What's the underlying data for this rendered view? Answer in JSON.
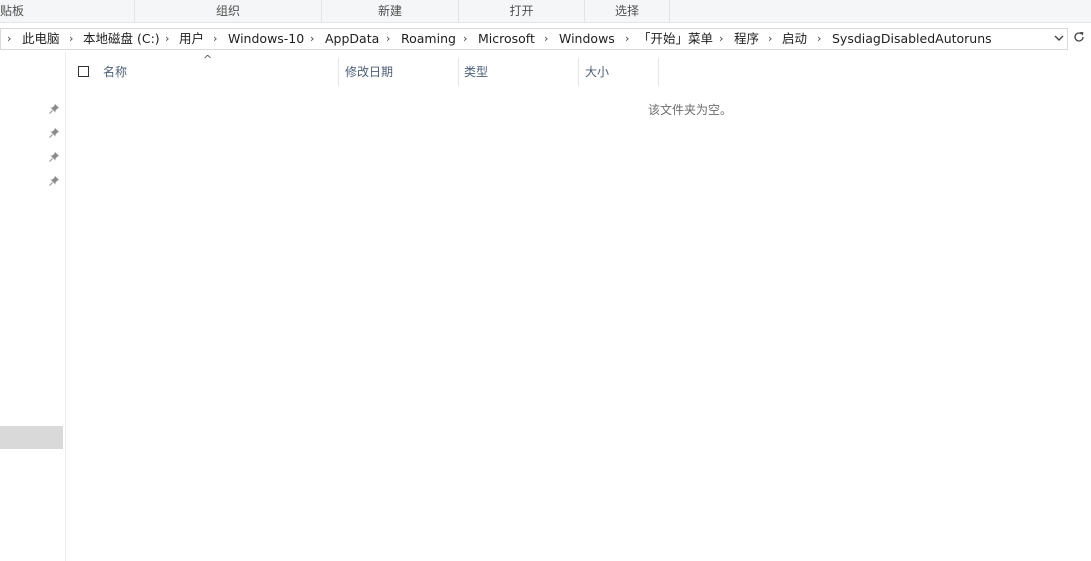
{
  "ribbon": {
    "groups": [
      "贴板",
      "组织",
      "新建",
      "打开",
      "选择"
    ]
  },
  "address_bar": {
    "crumbs": [
      "此电脑",
      "本地磁盘 (C:)",
      "用户",
      "Windows-10",
      "AppData",
      "Roaming",
      "Microsoft",
      "Windows",
      "「开始」菜单",
      "程序",
      "启动",
      "SysdiagDisabledAutoruns"
    ],
    "leading_chevron": "›",
    "separator": "›",
    "dropdown_icon": "chevron-down-icon",
    "refresh_icon": "refresh-icon"
  },
  "nav_pane": {
    "pins": [
      "pin-icon",
      "pin-icon",
      "pin-icon",
      "pin-icon"
    ]
  },
  "file_list": {
    "columns": [
      "名称",
      "修改日期",
      "类型",
      "大小"
    ],
    "sort_indicator": "^",
    "sorted_column": "名称",
    "empty_message": "该文件夹为空。"
  }
}
